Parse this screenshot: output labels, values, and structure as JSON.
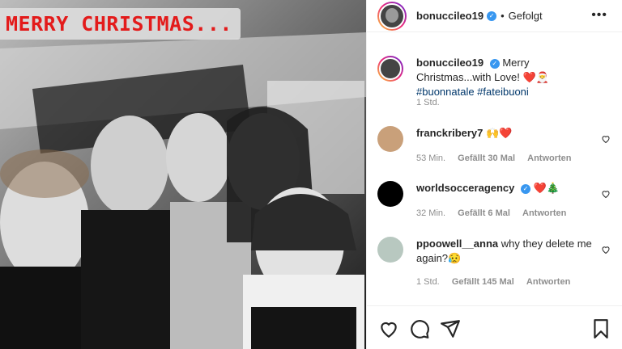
{
  "overlay_text": "MERRY CHRISTMAS...",
  "header": {
    "username": "bonuccileo19",
    "separator": "•",
    "follow_label": "Gefolgt"
  },
  "caption": {
    "username": "bonuccileo19",
    "text": "Merry Christmas...with Love!",
    "emojis": "❤️🎅",
    "hashtags": "#buonnatale #fateibuoni",
    "time": "1 Std."
  },
  "comments": [
    {
      "username": "franckribery7",
      "text": "🙌❤️",
      "time": "53 Min.",
      "likes": "Gefällt 30 Mal",
      "reply": "Antworten",
      "verified": false
    },
    {
      "username": "worldsocceragency",
      "text": "❤️🎄",
      "time": "32 Min.",
      "likes": "Gefällt 6 Mal",
      "reply": "Antworten",
      "verified": true
    },
    {
      "username": "ppoowell__anna",
      "text": "why they delete me again?😥",
      "time": "1 Std.",
      "likes": "Gefällt 145 Mal",
      "reply": "Antworten",
      "verified": false
    }
  ],
  "icons": {
    "like": "heart-icon",
    "comment": "comment-icon",
    "share": "send-icon",
    "save": "bookmark-icon",
    "more": "more-icon"
  },
  "colors": {
    "verified": "#3897f0",
    "heart": "#ed4956",
    "overlay_text": "#e31b1b"
  }
}
